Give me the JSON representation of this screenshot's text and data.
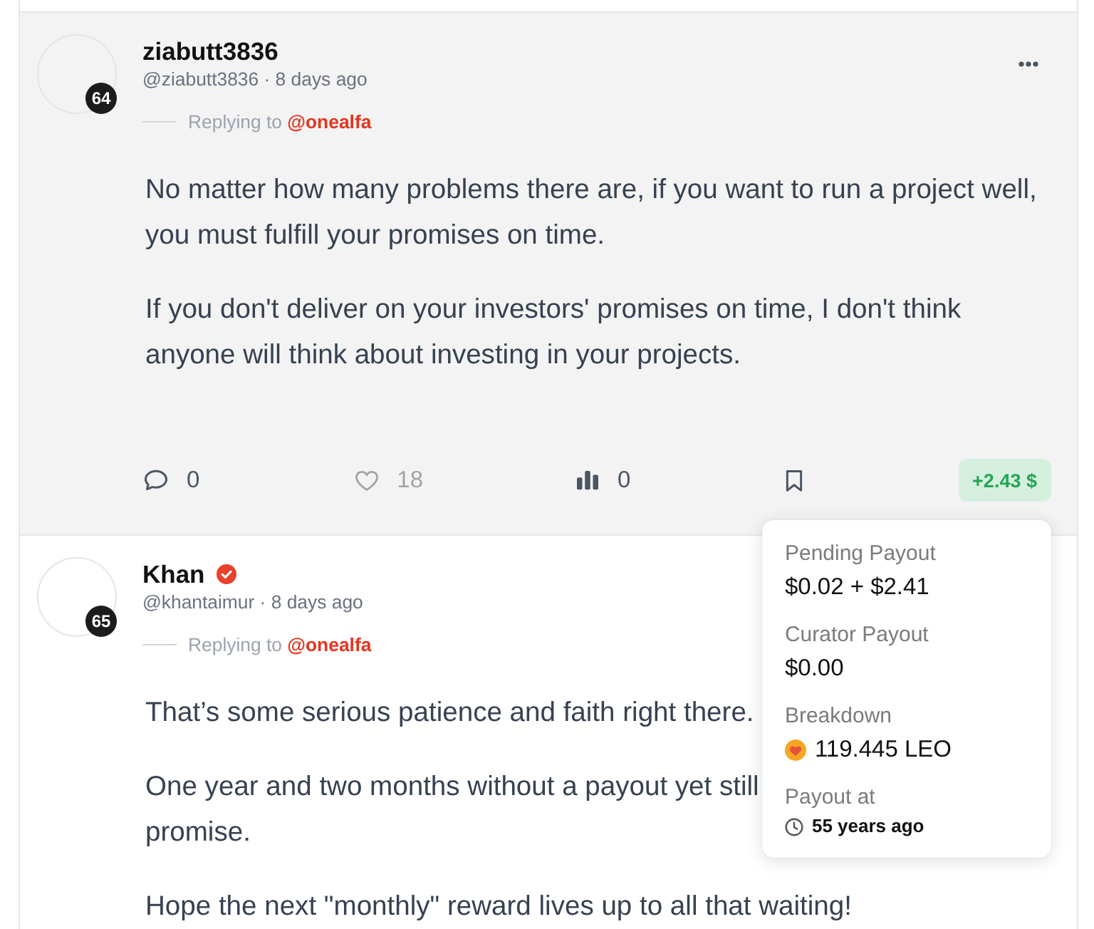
{
  "comments": [
    {
      "avatar_badge": "64",
      "name": "ziabutt3836",
      "verified": false,
      "byline": "@ziabutt3836 · 8 days ago",
      "reply_prefix": "Replying to",
      "reply_to": "@onealfa",
      "highlighted": true,
      "more_menu": true,
      "paragraphs": [
        {
          "lines": [
            "No matter how many problems there are, if you want to run a project well,",
            "you must fulfill your promises on time."
          ]
        },
        {
          "lines": [
            "If you don't deliver on your investors' promises on time, I don't think",
            "anyone will think about investing in your projects."
          ]
        }
      ],
      "actions": [
        {
          "kind": "comment",
          "count": "0",
          "disabled": false
        },
        {
          "kind": "vote",
          "count": "18",
          "disabled": true
        },
        {
          "kind": "stats",
          "count": "0",
          "disabled": false
        },
        {
          "kind": "bookmark",
          "disabled": false
        }
      ],
      "payout": {
        "label": "+2.43 $",
        "open": true,
        "details": [
          {
            "kind": "amount",
            "label": "Pending Payout",
            "value": "$0.02 + $2.41"
          },
          {
            "kind": "amount",
            "label": "Curator Payout",
            "value": "$0.00"
          },
          {
            "kind": "token",
            "label": "Breakdown",
            "value": "119.445 LEO"
          },
          {
            "kind": "time",
            "label": "Payout at",
            "value": "55 years ago"
          }
        ]
      }
    },
    {
      "avatar_badge": "65",
      "name": "Khan",
      "verified": true,
      "byline": "@khantaimur · 8 days ago",
      "reply_prefix": "Replying to",
      "reply_to": "@onealfa",
      "highlighted": false,
      "paragraphs": [
        {
          "lines": [
            "That’s some serious patience and faith right there."
          ]
        },
        {
          "lines": [
            "One year and two months without a payout yet still",
            "promise."
          ]
        },
        {
          "lines": [
            "Hope the next \"monthly\" reward lives up to all that waiting!"
          ]
        }
      ]
    }
  ]
}
